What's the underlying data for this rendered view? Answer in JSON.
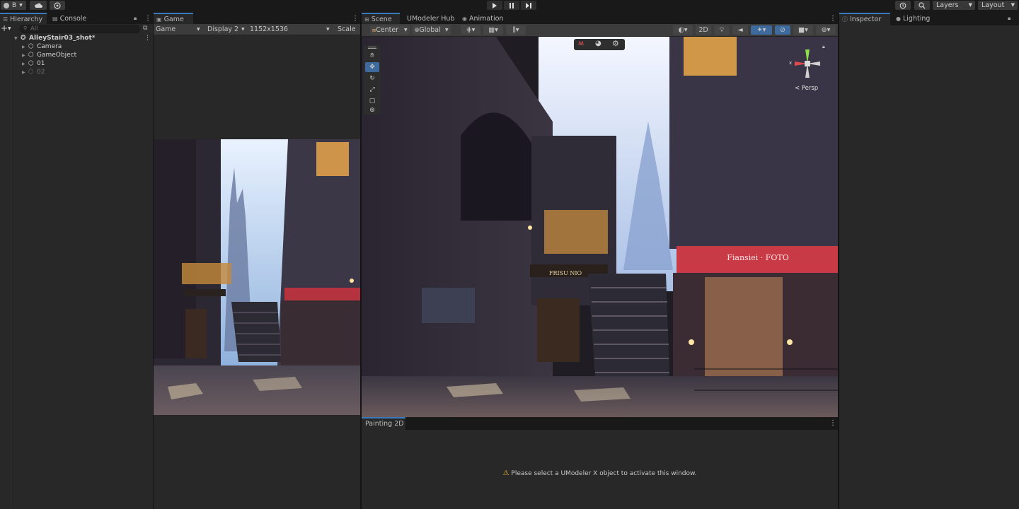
{
  "toolbar": {
    "account_label": "B",
    "layers_label": "Layers",
    "layout_label": "Layout"
  },
  "hierarchy": {
    "tab_label": "Hierarchy",
    "console_tab_label": "Console",
    "search_placeholder": "All",
    "scene_name": "AlleyStair03_shot*",
    "items": [
      {
        "label": "Camera",
        "dim": false
      },
      {
        "label": "GameObject",
        "dim": false
      },
      {
        "label": "01",
        "dim": false
      },
      {
        "label": "02",
        "dim": true
      }
    ]
  },
  "game": {
    "tab_label": "Game",
    "mode_label": "Game",
    "display_label": "Display 2",
    "resolution_label": "1152x1536",
    "scale_label": "Scale"
  },
  "scene": {
    "tab_label": "Scene",
    "umodeler_tab_label": "UModeler Hub",
    "animation_tab_label": "Animation",
    "pivot_label": "Center",
    "space_label": "Global",
    "mode_2d_label": "2D",
    "persp_label": "< Persp",
    "gizmo_x_label": "x",
    "shop_sign_left": "FRISU NIO",
    "shop_sign_right": "Fiansiei · FOTO"
  },
  "painting2d": {
    "tab_label": "Painting 2D",
    "message": "Please select a UModeler X object to activate this window."
  },
  "inspector": {
    "tab_label": "Inspector",
    "lighting_tab_label": "Lighting"
  },
  "colors": {
    "accent": "#3a79bb",
    "panel": "#282828",
    "tabbar": "#191919",
    "warning": "#f2b92b"
  }
}
